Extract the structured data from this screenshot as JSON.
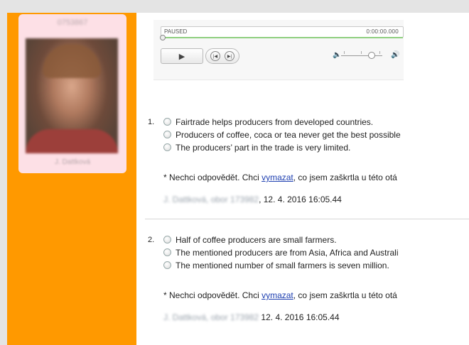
{
  "profile": {
    "name": "0753867",
    "subtitle": "J. Dattková"
  },
  "player": {
    "state": "PAUSED",
    "time": "0:00:00.000",
    "progress": 0,
    "volume": 0.75
  },
  "questions": [
    {
      "number": "1.",
      "options": [
        "Fairtrade helps producers from developed countries.",
        "Producers of coffee, coca or tea never get the best possible",
        "The producers’ part in the trade is very limited."
      ],
      "note_prefix": "* Nechci odpovědět. Chci ",
      "note_link": "vymazat",
      "note_suffix": ", co jsem zaškrtla u této otá",
      "meta_blur": "J. Dattková, obor 173982",
      "meta_time": ", 12. 4. 2016 16:05.44"
    },
    {
      "number": "2.",
      "options": [
        "Half of coffee producers are small farmers.",
        "The mentioned producers are from Asia, Africa and Australi",
        "The mentioned number of small farmers is seven million."
      ],
      "note_prefix": "* Nechci odpovědět. Chci ",
      "note_link": "vymazat",
      "note_suffix": ", co jsem zaškrtla u této otá",
      "meta_blur": "J. Dattková, obor 173982",
      "meta_time": " 12. 4. 2016 16:05.44"
    }
  ]
}
